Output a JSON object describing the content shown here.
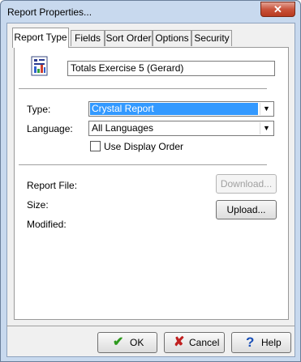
{
  "window": {
    "title": "Report Properties...",
    "close_icon": "close-icon",
    "close_glyph": "✕"
  },
  "tabs": [
    {
      "label": "Report Type",
      "active": true
    },
    {
      "label": "Fields"
    },
    {
      "label": "Sort Order"
    },
    {
      "label": "Options"
    },
    {
      "label": "Security"
    }
  ],
  "report": {
    "icon": "report-document-icon",
    "name": "Totals Exercise 5 (Gerard)"
  },
  "type": {
    "label": "Type:",
    "value": "Crystal Report",
    "arrow": "▼"
  },
  "language": {
    "label": "Language:",
    "value": "All Languages",
    "arrow": "▼"
  },
  "use_display_order": {
    "label": "Use Display Order",
    "checked": false
  },
  "file_info": {
    "report_file_label": "Report File:",
    "size_label": "Size:",
    "modified_label": "Modified:"
  },
  "buttons": {
    "download": "Download...",
    "upload": "Upload...",
    "ok": "OK",
    "cancel": "Cancel",
    "help": "Help",
    "ok_glyph": "✔",
    "cancel_glyph": "✘",
    "help_glyph": "?"
  },
  "colors": {
    "selection": "#3399ff",
    "ok_icon": "#2e9a1e",
    "cancel_icon": "#c02020",
    "help_icon": "#1a50b8"
  }
}
